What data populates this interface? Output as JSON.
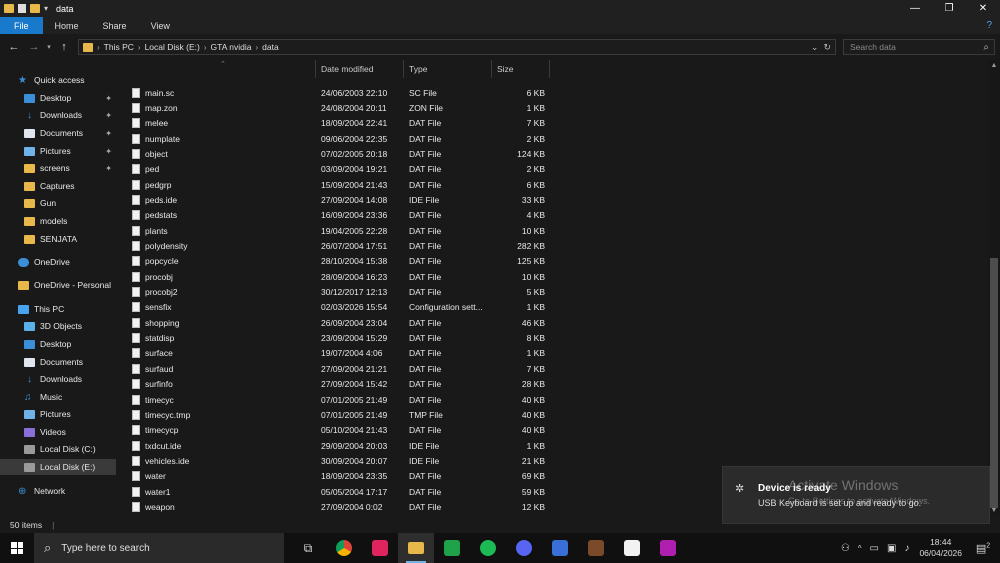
{
  "window": {
    "title": "data",
    "controls": {
      "minimize": "—",
      "maximize": "❐",
      "close": "✕"
    }
  },
  "ribbon": {
    "tabs": [
      "File",
      "Home",
      "Share",
      "View"
    ],
    "help": "?"
  },
  "address": {
    "path": [
      "This PC",
      "Local Disk (E:)",
      "GTA nvidia",
      "data"
    ],
    "search_placeholder": "Search data"
  },
  "sidebar": {
    "items": [
      {
        "label": "Quick access",
        "icon": "star-icon",
        "pinned": false
      },
      {
        "label": "Desktop",
        "icon": "desktop-icon",
        "pinned": true
      },
      {
        "label": "Downloads",
        "icon": "download-icon",
        "pinned": true
      },
      {
        "label": "Documents",
        "icon": "documents-icon",
        "pinned": true
      },
      {
        "label": "Pictures",
        "icon": "pictures-icon",
        "pinned": true
      },
      {
        "label": "screens",
        "icon": "folder-icon",
        "pinned": true
      },
      {
        "label": "Captures",
        "icon": "folder-icon",
        "pinned": false
      },
      {
        "label": "Gun",
        "icon": "folder-icon",
        "pinned": false
      },
      {
        "label": "models",
        "icon": "folder-icon",
        "pinned": false
      },
      {
        "label": "SENJATA",
        "icon": "folder-icon",
        "pinned": false
      },
      {
        "label": "OneDrive",
        "icon": "cloud-icon",
        "pinned": false
      },
      {
        "label": "OneDrive - Personal",
        "icon": "folder-icon",
        "pinned": false
      },
      {
        "label": "This PC",
        "icon": "computer-icon",
        "pinned": false
      },
      {
        "label": "3D Objects",
        "icon": "3d-objects-icon",
        "pinned": false
      },
      {
        "label": "Desktop",
        "icon": "desktop-icon",
        "pinned": false
      },
      {
        "label": "Documents",
        "icon": "documents-icon",
        "pinned": false
      },
      {
        "label": "Downloads",
        "icon": "download-icon",
        "pinned": false
      },
      {
        "label": "Music",
        "icon": "music-icon",
        "pinned": false
      },
      {
        "label": "Pictures",
        "icon": "pictures-icon",
        "pinned": false
      },
      {
        "label": "Videos",
        "icon": "videos-icon",
        "pinned": false
      },
      {
        "label": "Local Disk (C:)",
        "icon": "disk-icon",
        "pinned": false
      },
      {
        "label": "Local Disk (E:)",
        "icon": "disk-icon",
        "pinned": false,
        "selected": true
      },
      {
        "label": "Network",
        "icon": "network-icon",
        "pinned": false
      }
    ]
  },
  "columns": {
    "name": "Name",
    "date": "Date modified",
    "type": "Type",
    "size": "Size"
  },
  "files": [
    {
      "name": "main.sc",
      "date": "24/06/2003 22:10",
      "type": "SC File",
      "size": "6 KB"
    },
    {
      "name": "map.zon",
      "date": "24/08/2004 20:11",
      "type": "ZON File",
      "size": "1 KB"
    },
    {
      "name": "melee",
      "date": "18/09/2004 22:41",
      "type": "DAT File",
      "size": "7 KB"
    },
    {
      "name": "numplate",
      "date": "09/06/2004 22:35",
      "type": "DAT File",
      "size": "2 KB"
    },
    {
      "name": "object",
      "date": "07/02/2005 20:18",
      "type": "DAT File",
      "size": "124 KB"
    },
    {
      "name": "ped",
      "date": "03/09/2004 19:21",
      "type": "DAT File",
      "size": "2 KB"
    },
    {
      "name": "pedgrp",
      "date": "15/09/2004 21:43",
      "type": "DAT File",
      "size": "6 KB"
    },
    {
      "name": "peds.ide",
      "date": "27/09/2004 14:08",
      "type": "IDE File",
      "size": "33 KB"
    },
    {
      "name": "pedstats",
      "date": "16/09/2004 23:36",
      "type": "DAT File",
      "size": "4 KB"
    },
    {
      "name": "plants",
      "date": "19/04/2005 22:28",
      "type": "DAT File",
      "size": "10 KB"
    },
    {
      "name": "polydensity",
      "date": "26/07/2004 17:51",
      "type": "DAT File",
      "size": "282 KB"
    },
    {
      "name": "popcycle",
      "date": "28/10/2004 15:38",
      "type": "DAT File",
      "size": "125 KB"
    },
    {
      "name": "procobj",
      "date": "28/09/2004 16:23",
      "type": "DAT File",
      "size": "10 KB"
    },
    {
      "name": "procobj2",
      "date": "30/12/2017 12:13",
      "type": "DAT File",
      "size": "5 KB"
    },
    {
      "name": "sensfix",
      "date": "02/03/2026 15:54",
      "type": "Configuration sett...",
      "size": "1 KB"
    },
    {
      "name": "shopping",
      "date": "26/09/2004 23:04",
      "type": "DAT File",
      "size": "46 KB"
    },
    {
      "name": "statdisp",
      "date": "23/09/2004 15:29",
      "type": "DAT File",
      "size": "8 KB"
    },
    {
      "name": "surface",
      "date": "19/07/2004 4:06",
      "type": "DAT File",
      "size": "1 KB"
    },
    {
      "name": "surfaud",
      "date": "27/09/2004 21:21",
      "type": "DAT File",
      "size": "7 KB"
    },
    {
      "name": "surfinfo",
      "date": "27/09/2004 15:42",
      "type": "DAT File",
      "size": "28 KB"
    },
    {
      "name": "timecyc",
      "date": "07/01/2005 21:49",
      "type": "DAT File",
      "size": "40 KB"
    },
    {
      "name": "timecyc.tmp",
      "date": "07/01/2005 21:49",
      "type": "TMP File",
      "size": "40 KB"
    },
    {
      "name": "timecycp",
      "date": "05/10/2004 21:43",
      "type": "DAT File",
      "size": "40 KB"
    },
    {
      "name": "txdcut.ide",
      "date": "29/09/2004 20:03",
      "type": "IDE File",
      "size": "1 KB"
    },
    {
      "name": "vehicles.ide",
      "date": "30/09/2004 20:07",
      "type": "IDE File",
      "size": "21 KB"
    },
    {
      "name": "water",
      "date": "18/09/2004 23:35",
      "type": "DAT File",
      "size": "69 KB"
    },
    {
      "name": "water1",
      "date": "05/05/2004 17:17",
      "type": "DAT File",
      "size": "59 KB"
    },
    {
      "name": "weapon",
      "date": "27/09/2004 0:02",
      "type": "DAT File",
      "size": "12 KB"
    }
  ],
  "status": {
    "count": "50 items"
  },
  "toast": {
    "title": "Device is ready",
    "message": "USB Keyboard is set up and ready to go."
  },
  "watermark": {
    "title": "Activate Windows",
    "subtitle": "Go to Settings to activate Windows."
  },
  "taskbar": {
    "search_placeholder": "Type here to search",
    "time": "18:44",
    "date": "06/04/2026",
    "notifications": "2"
  },
  "colors": {
    "accent": "#1979ca",
    "folder": "#e8b84a"
  }
}
